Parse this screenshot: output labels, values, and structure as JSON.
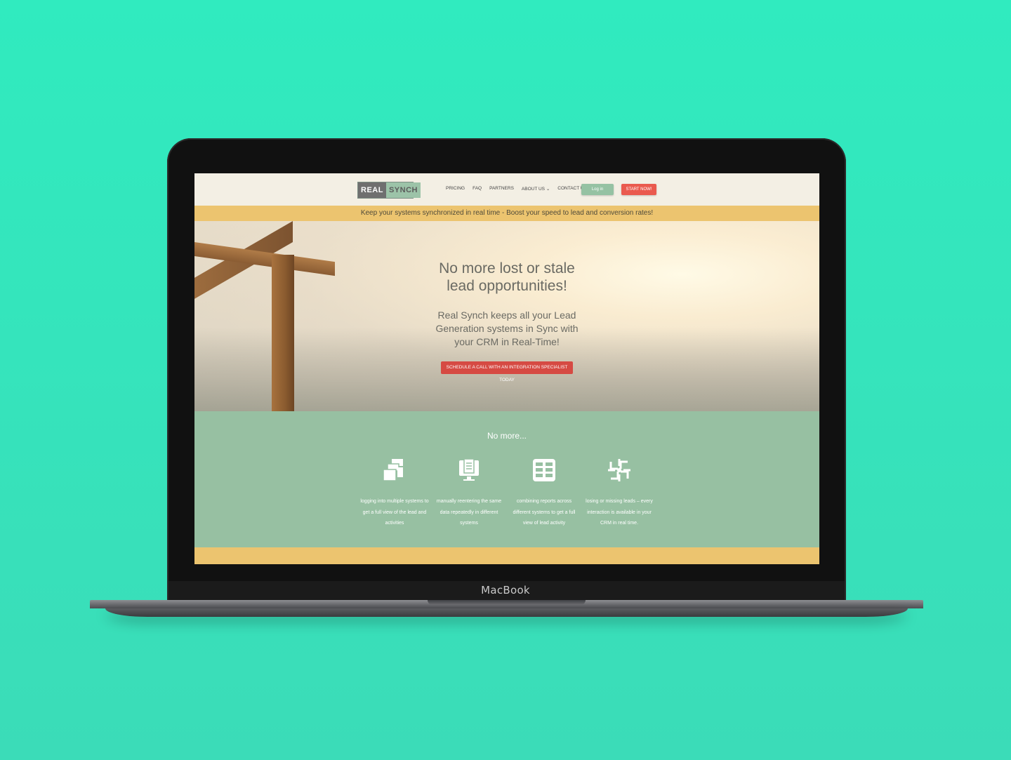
{
  "device": {
    "brand": "MacBook"
  },
  "site": {
    "logo": {
      "part1": "REAL",
      "part2": "SYNCH"
    },
    "nav": [
      "PRICING",
      "FAQ",
      "PARTNERS",
      "ABOUT US ⌄",
      "CONTACT US"
    ],
    "login_label": "Log in",
    "start_label": "START NOW!",
    "banner": "Keep your systems synchronized in real time - Boost your speed to lead and conversion rates!",
    "hero": {
      "title_line1": "No more lost or stale",
      "title_line2": "lead opportunities!",
      "sub_line1": "Real Synch keeps all your Lead",
      "sub_line2": "Generation systems in Sync with",
      "sub_line3": "your CRM in Real-Time!",
      "cta": "SCHEDULE A CALL WITH AN INTEGRATION SPECIALIST TODAY"
    },
    "features": {
      "heading": "No more...",
      "items": [
        {
          "icon": "multiple-windows-icon",
          "line1": "logging into multiple systems to",
          "line2": "get a full view of the lead and",
          "line3": "activities"
        },
        {
          "icon": "monitor-document-icon",
          "line1": "manually reentering the same",
          "line2": "data repeatedly in different",
          "line3": "systems"
        },
        {
          "icon": "reports-columns-icon",
          "line1": "combining reports across",
          "line2": "different systems to get a full",
          "line3": "view of lead activity"
        },
        {
          "icon": "arrows-puzzle-icon",
          "line1": "losing or missing leads – every",
          "line2": "interaction is available in your",
          "line3": "CRM in real time."
        }
      ]
    }
  },
  "colors": {
    "background": "#33e8bd",
    "banner": "#ecc46f",
    "features_bg": "#97c0a2",
    "cta_red": "#d64a43",
    "login_green": "#95c2a3"
  }
}
